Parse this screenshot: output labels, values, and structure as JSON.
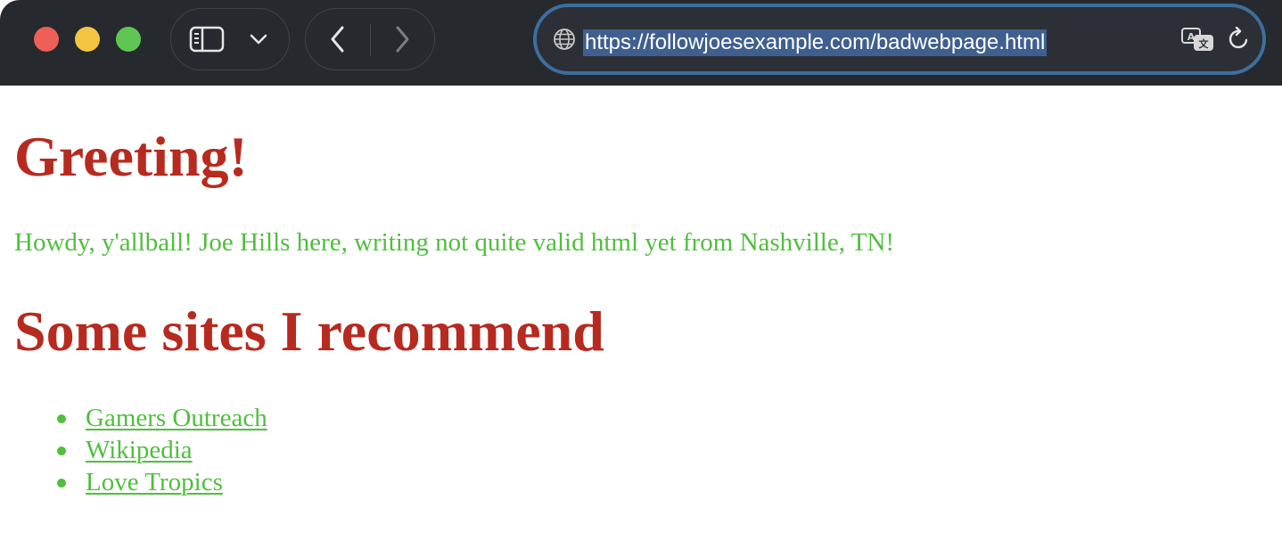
{
  "browser": {
    "url": "https://followjoesexample.com/badwebpage.html",
    "icons": {
      "sidebar": "sidebar-icon",
      "tabs_menu": "chevron-down-icon",
      "back": "chevron-left-icon",
      "forward": "chevron-right-icon",
      "site": "globe-icon",
      "translate": "translate-icon",
      "reload": "reload-icon"
    },
    "colors": {
      "toolbar": "#26292e",
      "url_focus_ring": "#3d6f9e",
      "url_selection": "#3f5f8f",
      "close": "#ed5f57",
      "minimize": "#f5c443",
      "maximize": "#5fc653"
    }
  },
  "page": {
    "heading1": "Greeting!",
    "intro": "Howdy, y'allball! Joe Hills here, writing not quite valid html yet from Nashville, TN!",
    "heading2": "Some sites I recommend",
    "links": [
      {
        "label": "Gamers Outreach"
      },
      {
        "label": "Wikipedia"
      },
      {
        "label": "Love Tropics"
      }
    ],
    "colors": {
      "heading": "#b72a1f",
      "text": "#4fbf3d"
    }
  }
}
